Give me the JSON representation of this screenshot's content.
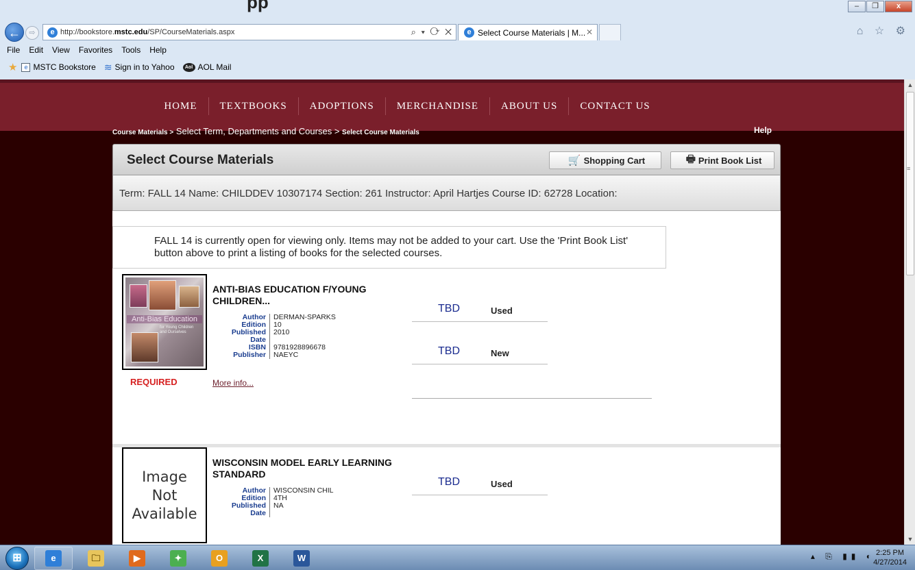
{
  "window": {
    "partial_title": "pp",
    "buttons": [
      "–",
      "❐",
      "x"
    ]
  },
  "browser": {
    "back": "←",
    "forward": "⇨",
    "url_prefix": "http://bookstore.",
    "url_domain": "mstc.edu",
    "url_path": "/SP/CourseMaterials.aspx",
    "address_tools": "⌕ ▾ ⟳ ✕",
    "tab_title": "Select Course Materials | M...",
    "tab_close": "✕",
    "right_icons": "⌂ ☆ ⚙",
    "menu": [
      "File",
      "Edit",
      "View",
      "Favorites",
      "Tools",
      "Help"
    ],
    "favorites": [
      {
        "label": "MSTC Bookstore",
        "icon": "page-icon"
      },
      {
        "label": "Sign in to Yahoo",
        "icon": "yahoo-icon"
      },
      {
        "label": "AOL Mail",
        "icon": "aol-icon"
      }
    ]
  },
  "site": {
    "nav": [
      "HOME",
      "TEXTBOOKS",
      "ADOPTIONS",
      "MERCHANDISE",
      "ABOUT US",
      "CONTACT US"
    ],
    "breadcrumb": {
      "part1": "Course Materials >",
      "part2": " Select Term, Departments and Courses ",
      "part3": " > ",
      "part4": "Select Course Materials"
    },
    "help": "Help",
    "panel_title": "Select Course Materials",
    "cart_button": "Shopping Cart",
    "print_button": "Print Book List",
    "term_info": "Term: FALL 14 Name: CHILDDEV 10307174 Section: 261 Instructor: April Hartjes Course ID: 62728 Location:",
    "notice": "FALL 14 is currently open for viewing only. Items may not be added to your cart. Use the 'Print Book List' button above to print a listing of books for the selected courses."
  },
  "books": [
    {
      "title": "ANTI-BIAS EDUCATION F/YOUNG CHILDREN...",
      "cover_title": "Anti-Bias Education",
      "cover_subtitle": "for Young Children and Ourselves",
      "labels": {
        "author": "Author",
        "edition": "Edition",
        "published": "Published",
        "date": "Date",
        "isbn": "ISBN",
        "publisher": "Publisher"
      },
      "author": "DERMAN-SPARKS",
      "edition": "10",
      "published": "2010",
      "isbn": "9781928896678",
      "publisher": "NAEYC",
      "required": "REQUIRED",
      "more_info": "More info...",
      "prices": [
        {
          "price": "TBD",
          "condition": "Used"
        },
        {
          "price": "TBD",
          "condition": "New"
        }
      ]
    },
    {
      "title": "WISCONSIN MODEL EARLY LEARNING STANDARD",
      "no_image": [
        "Image",
        "Not",
        "Available"
      ],
      "labels": {
        "author": "Author",
        "edition": "Edition",
        "published": "Published",
        "date": "Date"
      },
      "author": "WISCONSIN CHIL",
      "edition": "4TH",
      "published": "NA",
      "prices": [
        {
          "price": "TBD",
          "condition": "Used"
        }
      ]
    }
  ],
  "taskbar": {
    "apps": [
      "e",
      "🗀",
      "▶",
      "✦",
      "O",
      "X",
      "W"
    ],
    "tray": "▴ ⎘ ▮▮ ◐",
    "time": "2:25 PM",
    "date": "4/27/2014"
  },
  "scrollbar": {
    "up": "▲",
    "down": "▼",
    "grip": "≡"
  },
  "colors": {
    "nav_bg": "#7a1f2b",
    "page_bg": "#2a0000",
    "required_red": "#d62020",
    "price_blue": "#1a2b8f",
    "label_blue": "#1a3d8f"
  }
}
